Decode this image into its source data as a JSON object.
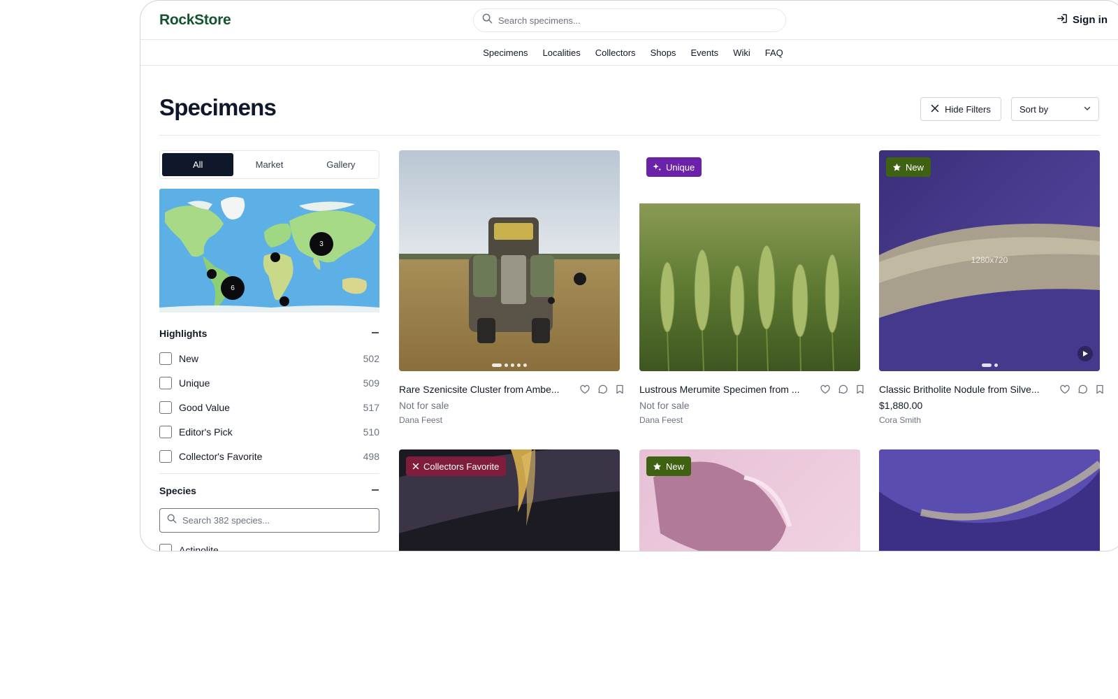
{
  "header": {
    "logo": "RockStore",
    "search_placeholder": "Search specimens...",
    "signin_label": "Sign in"
  },
  "nav": [
    "Specimens",
    "Localities",
    "Collectors",
    "Shops",
    "Events",
    "Wiki",
    "FAQ"
  ],
  "page": {
    "title": "Specimens",
    "hide_filters_label": "Hide Filters",
    "sort_label": "Sort by"
  },
  "tabs": {
    "all": "All",
    "market": "Market",
    "gallery": "Gallery"
  },
  "map": {
    "clusters": [
      {
        "count": "3",
        "region": "Asia"
      },
      {
        "count": "6",
        "region": "South America"
      }
    ]
  },
  "highlights": {
    "title": "Highlights",
    "items": [
      {
        "label": "New",
        "count": "502"
      },
      {
        "label": "Unique",
        "count": "509"
      },
      {
        "label": "Good Value",
        "count": "517"
      },
      {
        "label": "Editor's Pick",
        "count": "510"
      },
      {
        "label": "Collector's Favorite",
        "count": "498"
      }
    ]
  },
  "species": {
    "title": "Species",
    "search_placeholder": "Search 382 species...",
    "first_item": "Actinolite"
  },
  "cards": [
    {
      "title": "Rare Szenicsite Cluster from Ambe...",
      "price": "Not for sale",
      "seller": "Dana Feest",
      "badge": ""
    },
    {
      "title": "Lustrous Merumite Specimen from ...",
      "price": "Not for sale",
      "seller": "Dana Feest",
      "badge": "Unique"
    },
    {
      "title": "Classic Britholite Nodule from Silve...",
      "price": "$1,880.00",
      "seller": "Cora Smith",
      "badge": "New",
      "image_label": "1280x720"
    },
    {
      "badge": "Collectors Favorite"
    },
    {
      "badge": "New"
    },
    {
      "badge": ""
    }
  ],
  "colors": {
    "brand": "#14532d",
    "badge_unique": "#6b21a8",
    "badge_new": "#3f6212",
    "badge_collectors": "#7f1d3b",
    "active_tab": "#0f172a"
  }
}
